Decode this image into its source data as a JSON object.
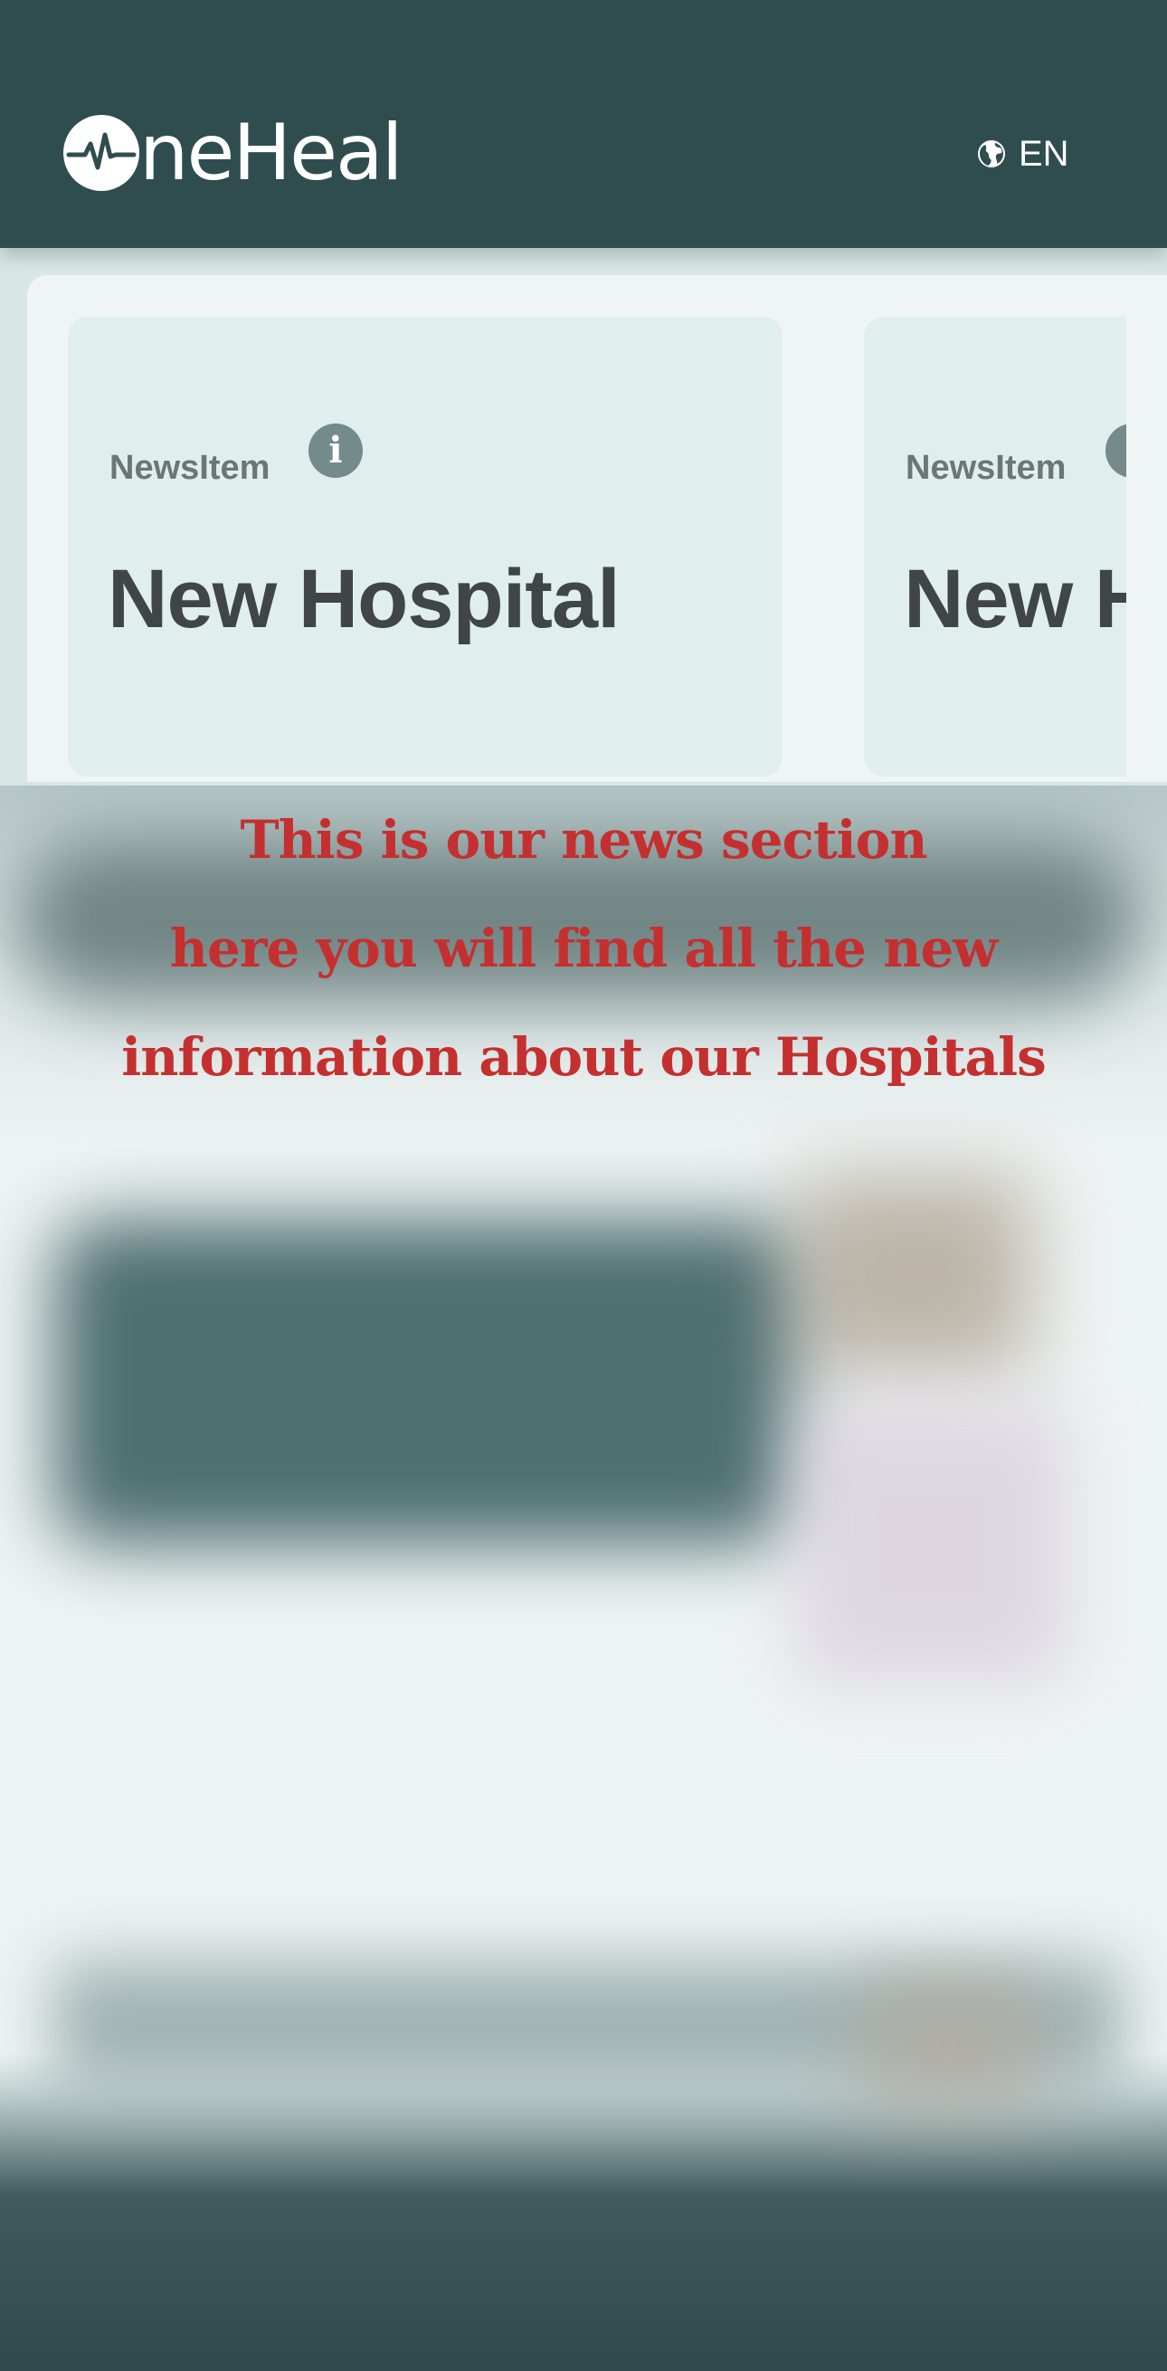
{
  "header": {
    "logo_text": "neHeal",
    "logo_icon": "pulse-circle-icon",
    "language": "EN",
    "language_icon": "globe-icon"
  },
  "news": {
    "cards": [
      {
        "kicker": "NewsItem",
        "title": "New Hospital",
        "icon": "info-icon"
      },
      {
        "kicker": "NewsItem",
        "title": "New H",
        "icon": "info-icon"
      }
    ]
  },
  "overlay_message": {
    "line1": "This is our news section",
    "line2": "here you will find all the new",
    "line3": "information about our Hospitals",
    "color": "#c4302f"
  },
  "colors": {
    "header_bg": "#2f4d4e",
    "card_bg": "#e0eeee",
    "accent": "#758a8b"
  }
}
